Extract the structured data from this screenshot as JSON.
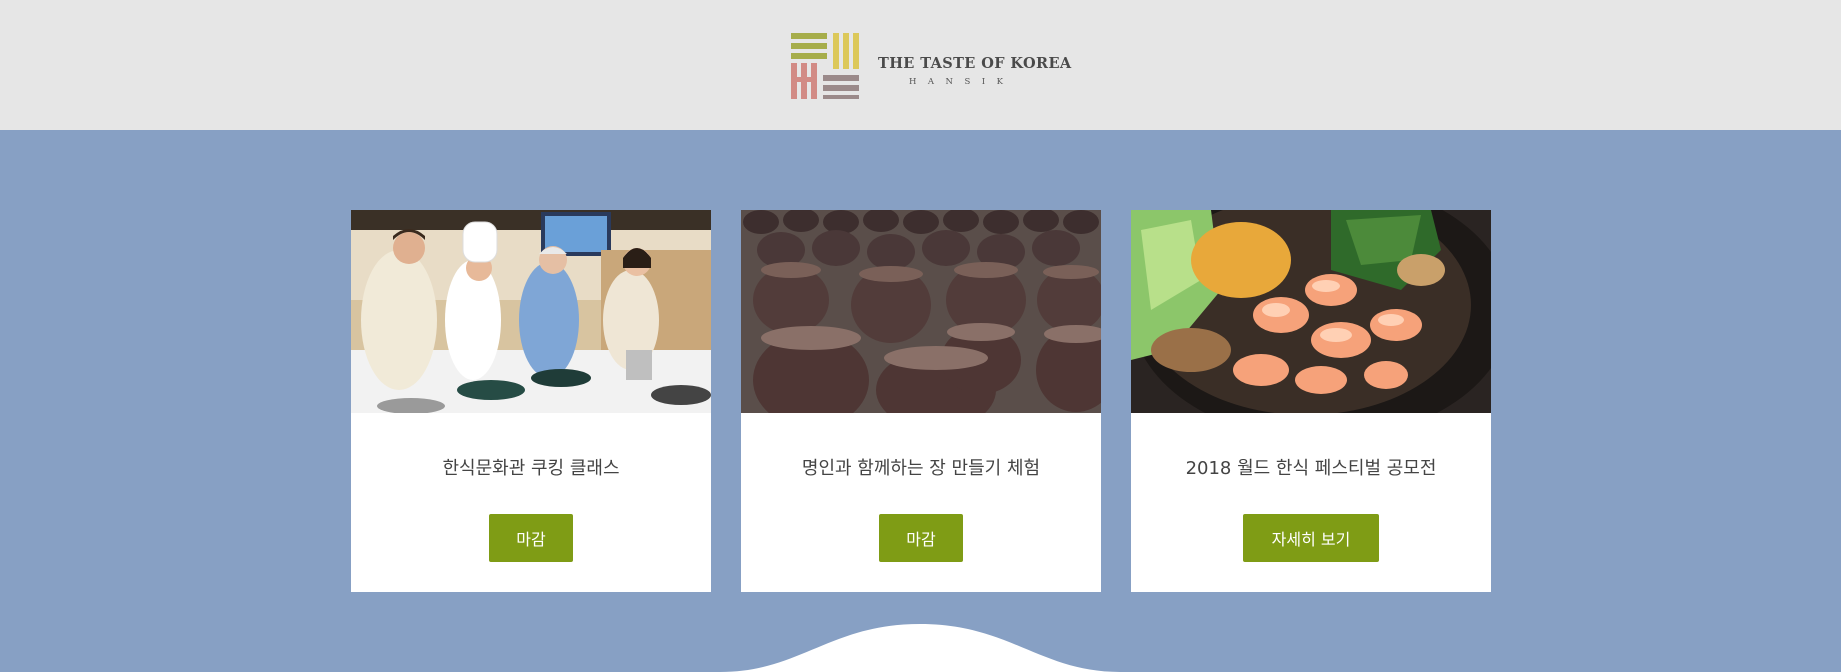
{
  "header": {
    "logo_title": "THE TASTE OF KOREA",
    "logo_subtitle": "HANSIK"
  },
  "cards": [
    {
      "title": "한식문화관 쿠킹 클래스",
      "button_label": "마감",
      "image_icon": "cooking-class-photo"
    },
    {
      "title": "명인과 함께하는 장 만들기 체험",
      "button_label": "마감",
      "image_icon": "jangdok-jars-photo"
    },
    {
      "title": "2018 월드 한식 페스티벌 공모전",
      "button_label": "자세히 보기",
      "image_icon": "bibimbap-shrimp-photo"
    }
  ],
  "colors": {
    "header_bg": "#e6e6e6",
    "main_bg": "#87a0c4",
    "button_bg": "#7f9c15",
    "logo_green": "#a6ad4a",
    "logo_yellow": "#dcc85a",
    "logo_red": "#d28b85",
    "logo_mauve": "#9b8a8a"
  }
}
